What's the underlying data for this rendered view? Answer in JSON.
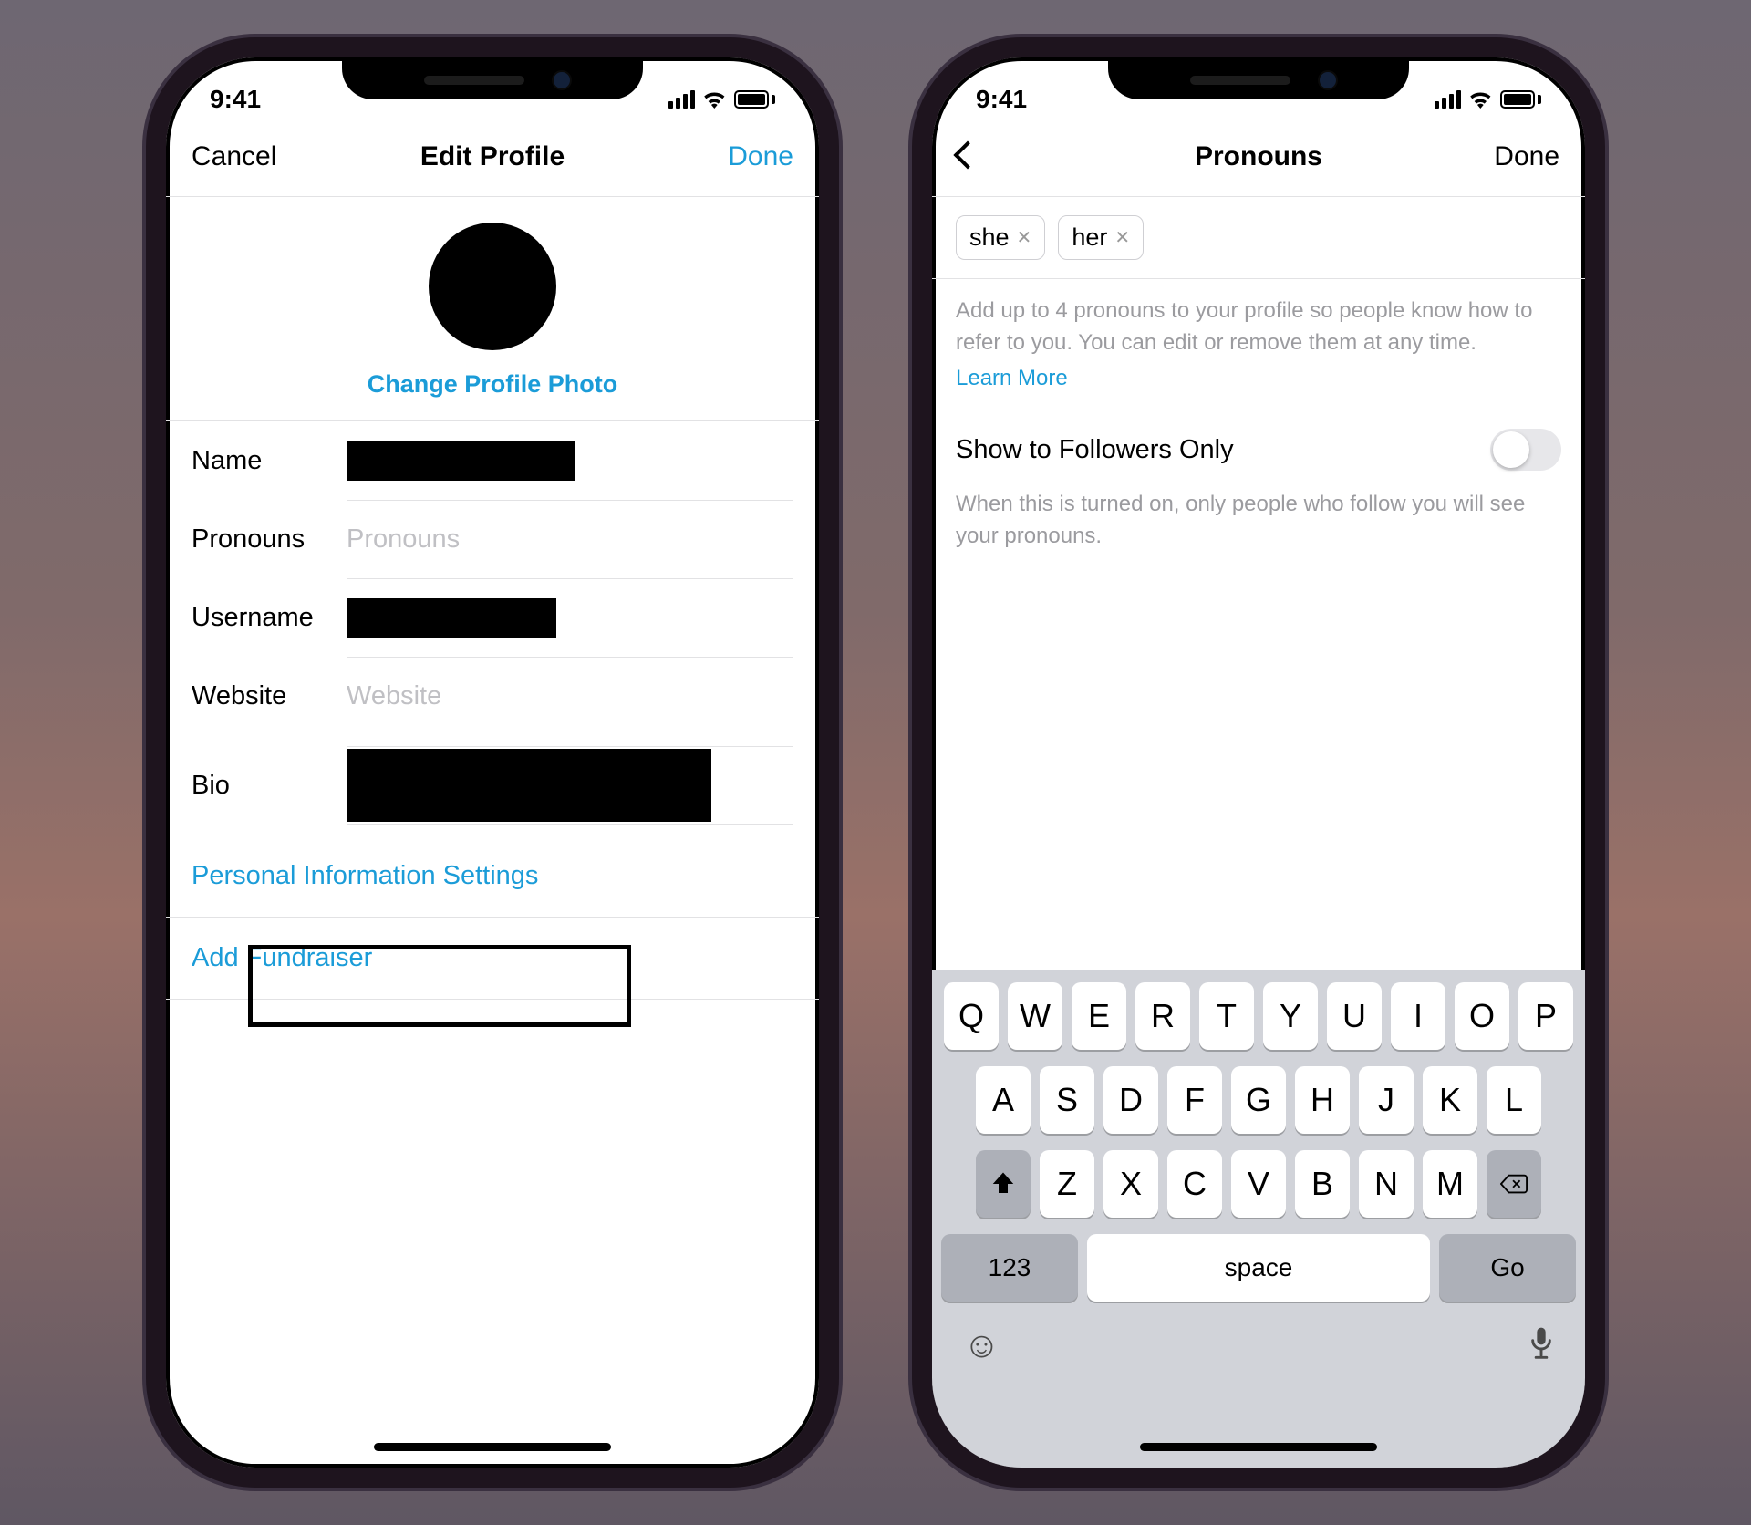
{
  "status": {
    "time": "9:41"
  },
  "phone1": {
    "nav": {
      "left": "Cancel",
      "title": "Edit Profile",
      "right": "Done"
    },
    "photo_link": "Change Profile Photo",
    "fields": {
      "name_label": "Name",
      "pronouns_label": "Pronouns",
      "pronouns_placeholder": "Pronouns",
      "username_label": "Username",
      "website_label": "Website",
      "website_placeholder": "Website",
      "bio_label": "Bio"
    },
    "links": {
      "personal_info": "Personal Information Settings",
      "add_fundraiser": "Add Fundraiser"
    }
  },
  "phone2": {
    "nav": {
      "title": "Pronouns",
      "right": "Done"
    },
    "chips": [
      "she",
      "her"
    ],
    "hint": "Add up to 4 pronouns to your profile so people know how to refer to you. You can edit or remove them at any time.",
    "learn_more": "Learn More",
    "toggle_label": "Show to Followers Only",
    "toggle_sub": "When this is turned on, only people who follow you will see your pronouns."
  },
  "keyboard": {
    "row1": [
      "Q",
      "W",
      "E",
      "R",
      "T",
      "Y",
      "U",
      "I",
      "O",
      "P"
    ],
    "row2": [
      "A",
      "S",
      "D",
      "F",
      "G",
      "H",
      "J",
      "K",
      "L"
    ],
    "row3": [
      "Z",
      "X",
      "C",
      "V",
      "B",
      "N",
      "M"
    ],
    "num": "123",
    "space": "space",
    "go": "Go"
  }
}
